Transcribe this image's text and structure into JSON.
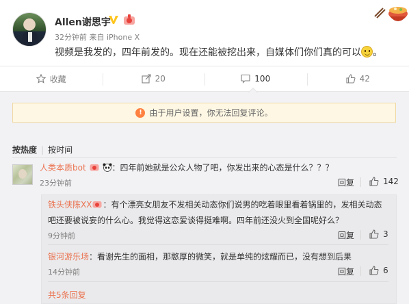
{
  "post": {
    "username": "Allen谢思宇",
    "time": "32分钟前",
    "source": "来自 iPhone X",
    "text": "视频是我发的，四年前发的。现在还能被挖出来，自媒体们你们真的可以",
    "text_end": "。"
  },
  "actions": [
    {
      "label": "收藏",
      "icon": "star-icon"
    },
    {
      "label": "20",
      "icon": "repost-icon"
    },
    {
      "label": "100",
      "icon": "comment-icon"
    },
    {
      "label": "42",
      "icon": "thumbs-up-icon"
    }
  ],
  "notice": {
    "text": "由于用户设置，你无法回复评论。",
    "icon": "warning-icon"
  },
  "sort": {
    "hot": "按热度",
    "time": "按时间"
  },
  "comments": [
    {
      "name": "人类本质bot",
      "text": "：四年前她就是公众人物了吧，你发出来的心态是什么？？？",
      "time": "23分钟前",
      "reply": "回复",
      "likes": "142"
    }
  ],
  "subcomments": [
    {
      "name": "铁头侠陈XX",
      "text1": "：有个漂亮女朋友不发相关动态你们说男的吃着眼里看着锅里的，发相关动态",
      "text2": "吧还要被说妄的什么心。我觉得这恋爱谈得挺难啊。四年前还没火到全国呢好么？",
      "time": "9分钟前",
      "reply": "回复",
      "likes": "3"
    },
    {
      "name": "银河游乐场",
      "text1": "：看谢先生的面相，那憨厚的微笑，就是单纯的炫耀而已，没有想到后果",
      "time": "14分钟前",
      "reply": "回复",
      "likes": "6"
    }
  ],
  "more_replies": "共5条回复",
  "colors": {
    "accent": "#eb7350",
    "verified": "#ffc51d",
    "notice_bg": "#fdf7e3"
  }
}
